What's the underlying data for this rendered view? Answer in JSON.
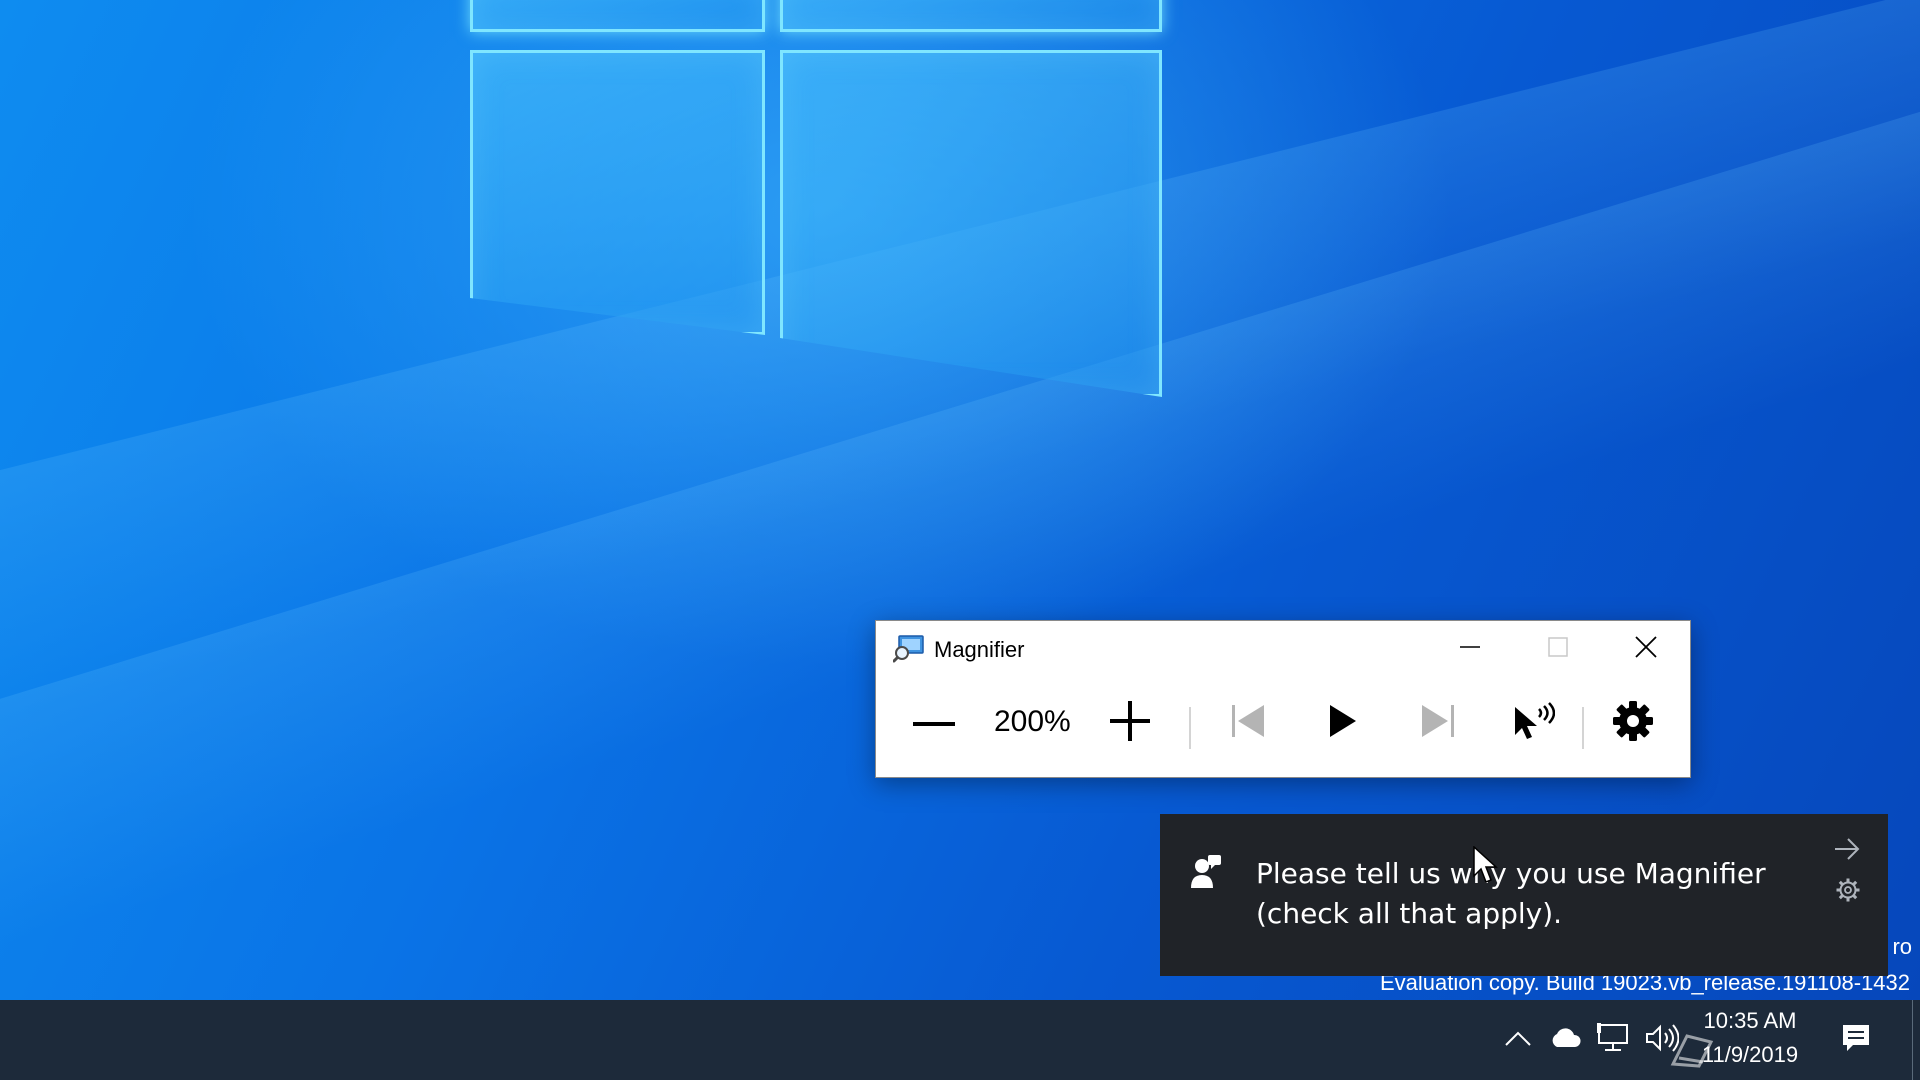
{
  "desktop": {
    "watermark_partial": "ro",
    "watermark_line": "Evaluation copy. Build 19023.vb_release.191108-1432"
  },
  "magnifier": {
    "title": "Magnifier",
    "zoom_level": "200%",
    "icons": {
      "app": "magnifier-app-icon",
      "minimize": "minimize-icon",
      "maximize": "maximize-icon",
      "close": "close-icon",
      "zoom_out": "minus-icon",
      "zoom_in": "plus-icon",
      "previous": "skip-previous-icon",
      "play": "play-icon",
      "next": "skip-next-icon",
      "read_from_pointer": "pointer-read-aloud-icon",
      "settings": "gear-icon"
    }
  },
  "toast": {
    "line1": "Please tell us why you use Magnifier",
    "line2": "(check all that apply).",
    "icons": {
      "app": "feedback-hub-icon",
      "dismiss": "arrow-right-icon",
      "settings": "gear-icon"
    }
  },
  "taskbar": {
    "time": "10:35 AM",
    "date": "11/9/2019",
    "tray_icons": [
      "chevron-up-icon",
      "onedrive-cloud-icon",
      "network-icon",
      "volume-icon",
      "pen-workspace-icon",
      "action-center-icon"
    ]
  },
  "colors": {
    "desktop_accent": "#0a73e6",
    "logo_glow": "#7fe6ff",
    "toast_background": "#202328",
    "taskbar_background": "#1d2a3a",
    "window_background": "#ffffff"
  }
}
